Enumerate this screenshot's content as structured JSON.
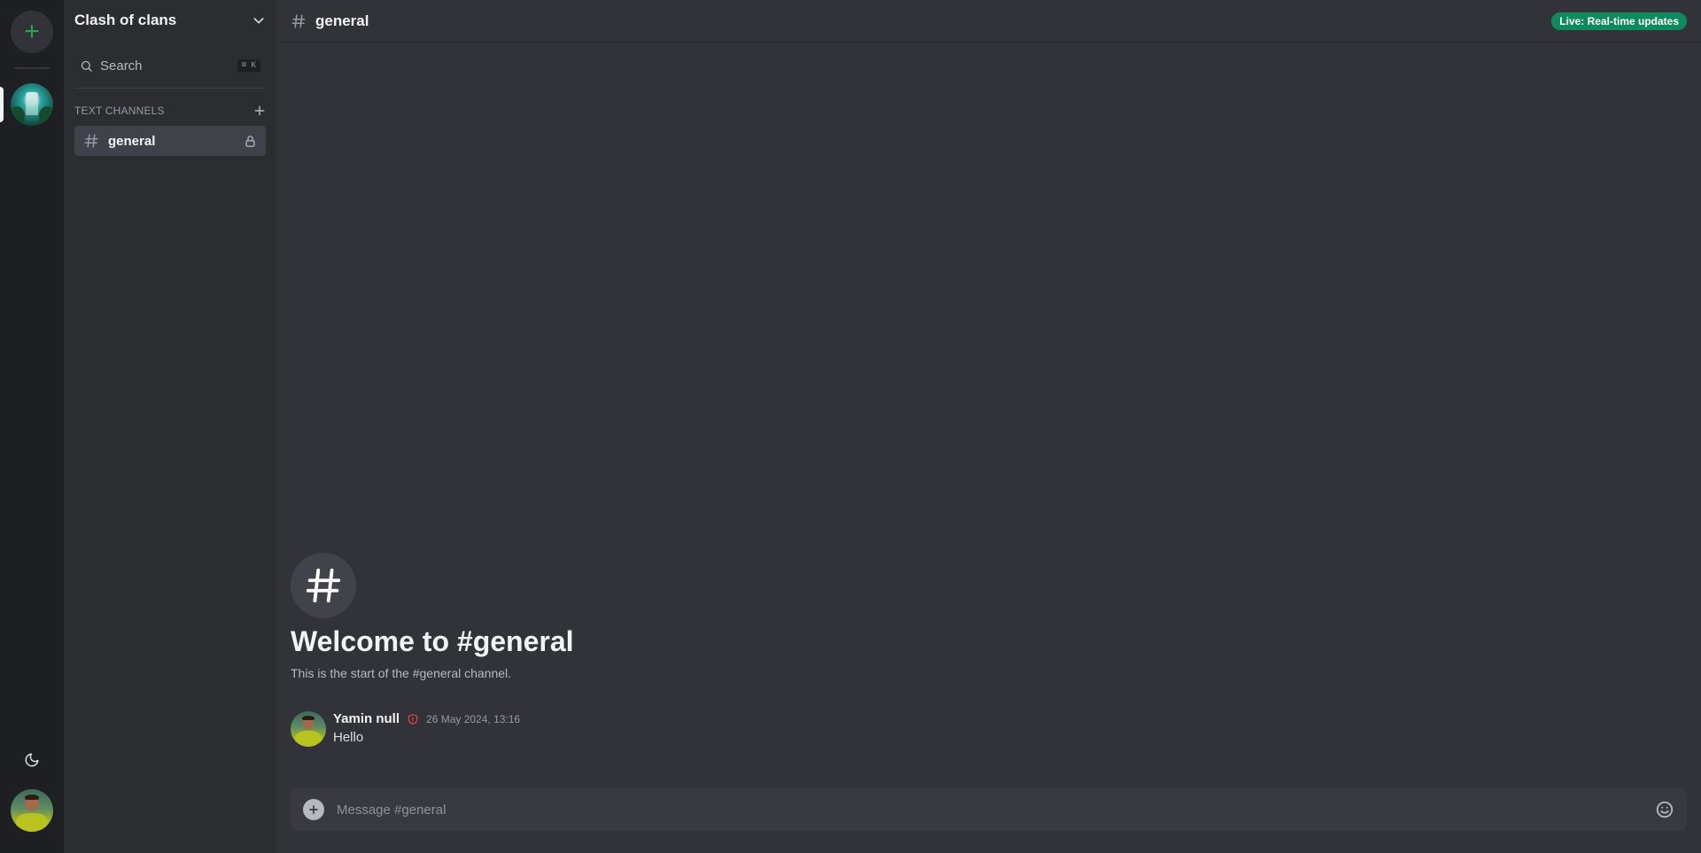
{
  "server": {
    "name": "Clash of clans",
    "add_server_icon": "plus-icon",
    "theme_icon": "moon-icon"
  },
  "search": {
    "label": "Search",
    "shortcut": "⌘ K"
  },
  "channels": {
    "category": "TEXT CHANNELS",
    "items": [
      {
        "name": "general",
        "icon": "hash-icon",
        "status_icon": "lock-icon"
      }
    ]
  },
  "header": {
    "channel_name": "general",
    "live_badge": "Live: Real-time updates"
  },
  "welcome": {
    "title": "Welcome to #general",
    "subtitle": "This is the start of the #general channel."
  },
  "messages": [
    {
      "author": "Yamin null",
      "badge_icon": "shield-icon",
      "timestamp": "26 May 2024, 13:16",
      "text": "Hello"
    }
  ],
  "composer": {
    "placeholder": "Message #general"
  },
  "colors": {
    "accent_green": "#23a55a",
    "live_badge": "#0f8a5f",
    "shield_red": "#f23f43",
    "background": "#313338",
    "sidebar": "#2b2d31",
    "rail": "#1e1f22"
  }
}
